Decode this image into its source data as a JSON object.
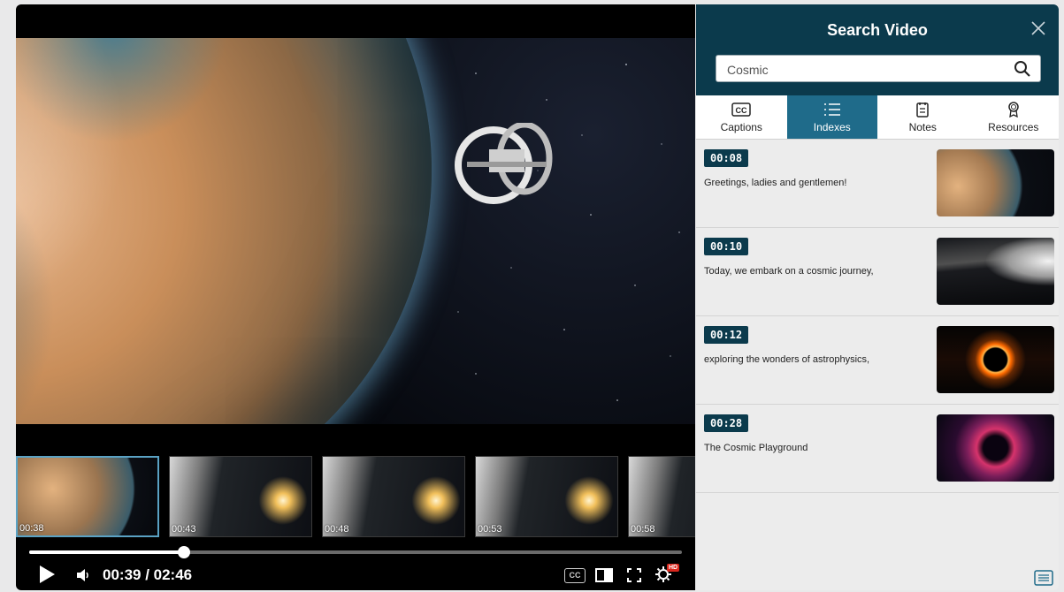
{
  "player": {
    "thumbnails": [
      {
        "time": "00:38"
      },
      {
        "time": "00:43"
      },
      {
        "time": "00:48"
      },
      {
        "time": "00:53"
      },
      {
        "time": "00:58"
      }
    ],
    "progress_fraction": 0.237,
    "time_display": "00:39 / 02:46",
    "cc_label": "CC",
    "hd_label": "HD"
  },
  "panel": {
    "title": "Search Video",
    "search": {
      "value": "Cosmic",
      "placeholder": "Search"
    },
    "tabs": [
      {
        "label": "Captions",
        "icon": "cc-icon",
        "active": false
      },
      {
        "label": "Indexes",
        "icon": "list-icon",
        "active": true
      },
      {
        "label": "Notes",
        "icon": "notes-icon",
        "active": false
      },
      {
        "label": "Resources",
        "icon": "award-icon",
        "active": false
      }
    ],
    "results": [
      {
        "timestamp": "00:08",
        "text": "Greetings, ladies and gentlemen!"
      },
      {
        "timestamp": "00:10",
        "text": "Today, we embark on a cosmic journey,"
      },
      {
        "timestamp": "00:12",
        "text": "exploring the wonders of astrophysics,"
      },
      {
        "timestamp": "00:28",
        "text": "The Cosmic Playground"
      }
    ]
  },
  "colors": {
    "panel_header": "#0b3a4c",
    "active_tab": "#1f6b8a",
    "hd_badge": "#d9261c"
  }
}
